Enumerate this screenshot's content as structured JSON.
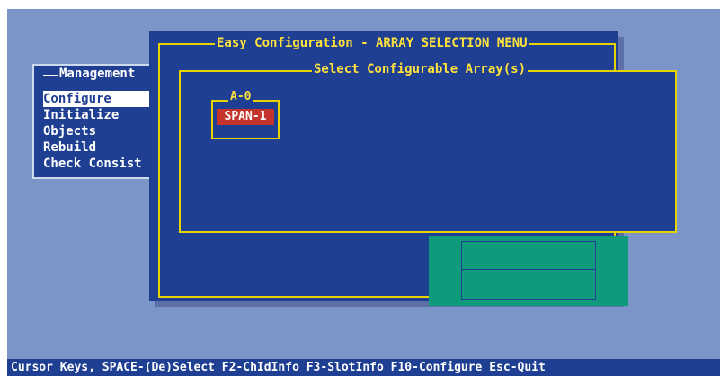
{
  "management_menu": {
    "title": "Management",
    "items": [
      {
        "label": "Configure",
        "selected": true
      },
      {
        "label": "Initialize",
        "selected": false
      },
      {
        "label": "Objects",
        "selected": false
      },
      {
        "label": "Rebuild",
        "selected": false
      },
      {
        "label": "Check Consist",
        "selected": false
      }
    ]
  },
  "main_window": {
    "title": "Easy Configuration - ARRAY SELECTION MENU",
    "subtitle": "Select Configurable Array(s)",
    "array": {
      "label": "A-0",
      "span": "SPAN-1"
    }
  },
  "status_bar": "Cursor Keys, SPACE-(De)Select F2-ChIdInfo F3-SlotInfo F10-Configure Esc-Quit",
  "colors": {
    "screen_background": "#7b95c8",
    "window_background": "#1f3f93",
    "frame": "#e8d200",
    "title_text": "#ffe23b",
    "selected_span": "#c4342d",
    "drive_panel": "#0f9a7c"
  }
}
